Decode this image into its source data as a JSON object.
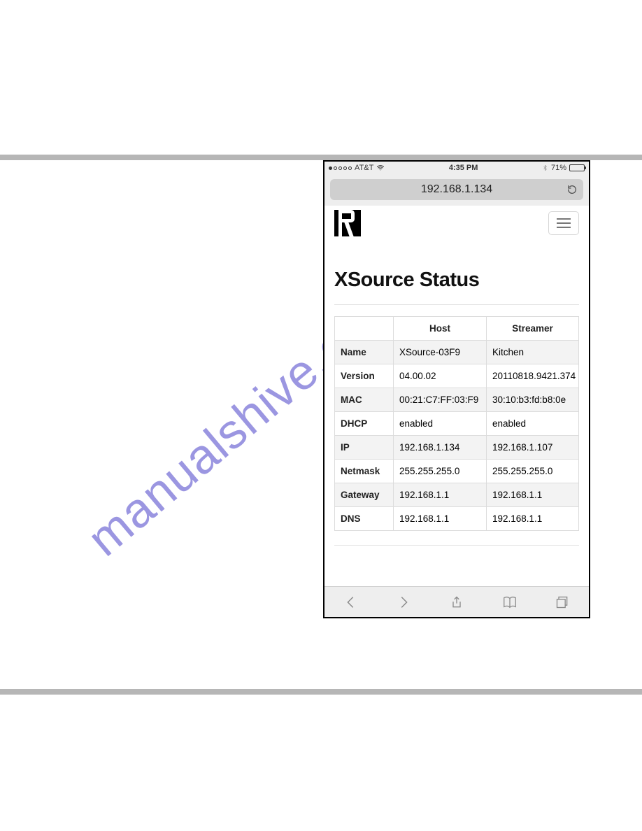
{
  "statusbar": {
    "carrier": "AT&T",
    "time": "4:35 PM",
    "battery_pct": "71%",
    "battery_fill_pct": 71
  },
  "urlbar": {
    "url": "192.168.1.134"
  },
  "page": {
    "title": "XSource Status"
  },
  "table": {
    "headers": {
      "blank": "",
      "host": "Host",
      "streamer": "Streamer"
    },
    "rows": [
      {
        "label": "Name",
        "host": "XSource-03F9",
        "streamer": "Kitchen"
      },
      {
        "label": "Version",
        "host": "04.00.02",
        "streamer": "20110818.9421.374"
      },
      {
        "label": "MAC",
        "host": "00:21:C7:FF:03:F9",
        "streamer": "30:10:b3:fd:b8:0e"
      },
      {
        "label": "DHCP",
        "host": "enabled",
        "streamer": "enabled"
      },
      {
        "label": "IP",
        "host": "192.168.1.134",
        "streamer": "192.168.1.107"
      },
      {
        "label": "Netmask",
        "host": "255.255.255.0",
        "streamer": "255.255.255.0"
      },
      {
        "label": "Gateway",
        "host": "192.168.1.1",
        "streamer": "192.168.1.1"
      },
      {
        "label": "DNS",
        "host": "192.168.1.1",
        "streamer": "192.168.1.1"
      }
    ]
  },
  "watermark": "manualshive.com"
}
